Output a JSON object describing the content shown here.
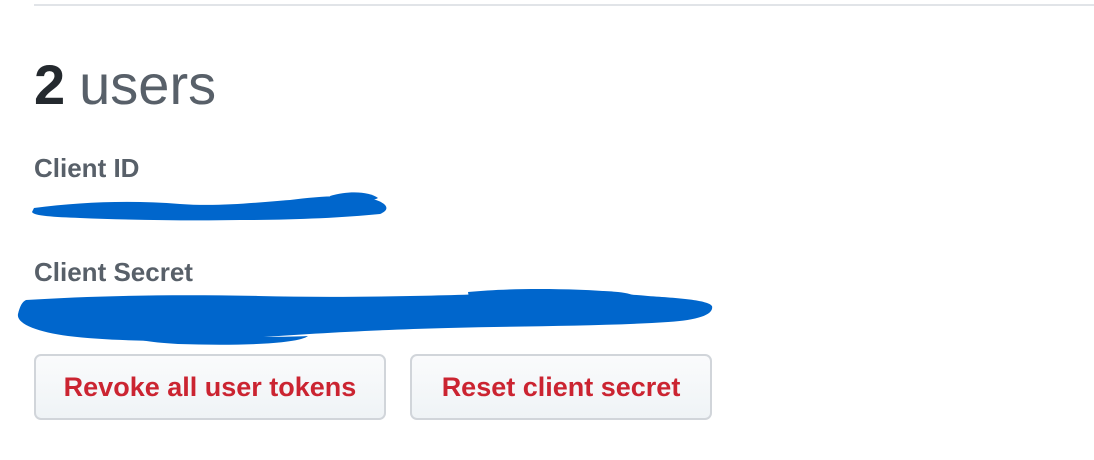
{
  "users": {
    "count": "2",
    "label": "users"
  },
  "credentials": {
    "client_id_label": "Client ID",
    "client_secret_label": "Client Secret"
  },
  "actions": {
    "revoke_label": "Revoke all user tokens",
    "reset_label": "Reset client secret"
  },
  "colors": {
    "danger_text": "#cb2431",
    "redaction_marker": "#0066cc",
    "muted_text": "#586069"
  }
}
